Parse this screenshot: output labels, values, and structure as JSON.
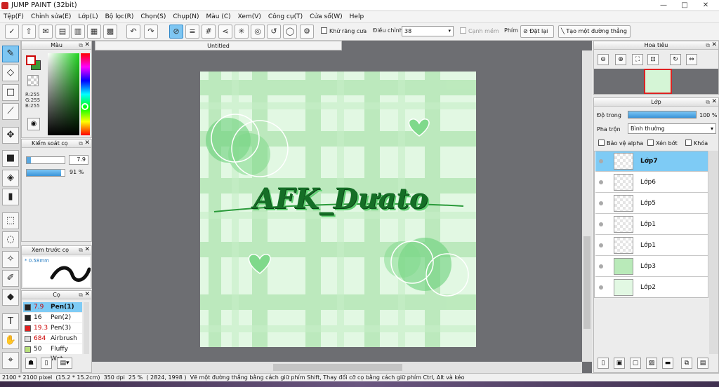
{
  "title": "JUMP PAINT (32bit)",
  "window_buttons": [
    "—",
    "□",
    "✕"
  ],
  "menu": [
    "Tệp(F)",
    "Chỉnh sửa(E)",
    "Lớp(L)",
    "Bộ lọc(R)",
    "Chọn(S)",
    "Chụp(N)",
    "Màu (C)",
    "Xem(V)",
    "Công cụ(T)",
    "Cửa sổ(W)",
    "Help"
  ],
  "toolbar": {
    "antialias": "Khử răng cưa",
    "adjust": "Điều chỉnh",
    "adjust_value": "38",
    "smooth": "Cạnh mềm",
    "pen_label": "Phím",
    "reset": "Đặt lại",
    "straight_line": "Tạo một đường thẳng"
  },
  "color_panel": {
    "title": "Màu",
    "rgb": [
      "R:255",
      "G:255",
      "B:255"
    ],
    "fg": "#ffffff",
    "bg": "#3a9a3a"
  },
  "brush_control": {
    "title": "Kiểm soát cọ",
    "size": "7.9",
    "opacity": "91 %",
    "opacity_fraction": 0.91
  },
  "preview": {
    "title": "Xem trước cọ",
    "size": "0.58mm"
  },
  "brushes": {
    "title": "Cọ",
    "items": [
      {
        "size": "7.9",
        "name": "Pen(1)",
        "color": "#222222"
      },
      {
        "size": "16",
        "name": "Pen(2)",
        "color": "#222222"
      },
      {
        "size": "19.3",
        "name": "Pen(3)",
        "color": "#e02020"
      },
      {
        "size": "684",
        "name": "Airbrush",
        "color": "#dddddd"
      },
      {
        "size": "50",
        "name": "Fluffy Wat",
        "color": "#b7e07a"
      }
    ]
  },
  "document": {
    "tab": "Untitled",
    "text": "AFK_Dưato"
  },
  "navigator": {
    "title": "Hoa tiêu"
  },
  "layers": {
    "title": "Lớp",
    "opacity_label": "Độ trong",
    "opacity_value": "100 %",
    "blend_label": "Pha trộn",
    "blend_value": "Bình thường",
    "protect_alpha": "Bảo vệ alpha",
    "clip": "Xén bớt",
    "lock": "Khóa",
    "items": [
      "Lớp7",
      "Lớp6",
      "Lớp5",
      "Lớp1",
      "Lớp1",
      "Lớp3",
      "Lớp2"
    ]
  },
  "status": {
    "dims": "2100 * 2100 pixel",
    "cm": "(15.2 * 15.2cm)",
    "dpi": "350 dpi",
    "zoom": "25 %",
    "coords": "( 2824, 1998 )",
    "hint": "Vẽ một đường thẳng bằng cách giữ phím Shift, Thay đổi cỡ cọ bằng cách giữ phím Ctrl, Alt và kéo"
  }
}
